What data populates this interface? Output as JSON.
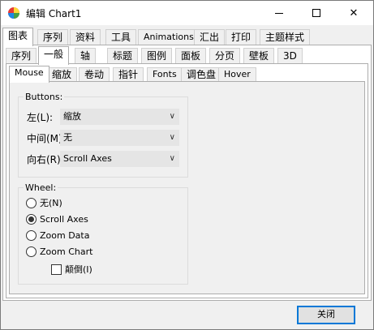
{
  "window": {
    "title": "编辑 Chart1",
    "icon": "chart-app-icon",
    "controls": {
      "minimize": "minimize-icon",
      "maximize": "maximize-icon",
      "close": "close-icon"
    }
  },
  "tabs_level1": [
    "图表",
    "序列",
    "资料",
    "工具",
    "Animations",
    "汇出",
    "打印",
    "主题样式"
  ],
  "tabs_level2": [
    "序列",
    "一般",
    "轴",
    "标题",
    "图例",
    "面板",
    "分页",
    "壁板",
    "3D"
  ],
  "tabs_level3": [
    "Mouse",
    "缩放",
    "卷动",
    "指针",
    "Fonts",
    "调色盘",
    "Hover"
  ],
  "buttons_group": {
    "label": "Buttons:",
    "left_label": "左(L):",
    "left_value": "缩放",
    "middle_label": "中间(M)",
    "middle_value": "无",
    "right_label": "向右(R)",
    "right_value": "Scroll Axes"
  },
  "wheel_group": {
    "label": "Wheel:",
    "options": [
      "无(N)",
      "Scroll Axes",
      "Zoom Data",
      "Zoom Chart"
    ],
    "checkbox": "颠倒(I)"
  },
  "footer": {
    "close_label": "关闭"
  },
  "colors": {
    "accent": "#0078d7"
  }
}
